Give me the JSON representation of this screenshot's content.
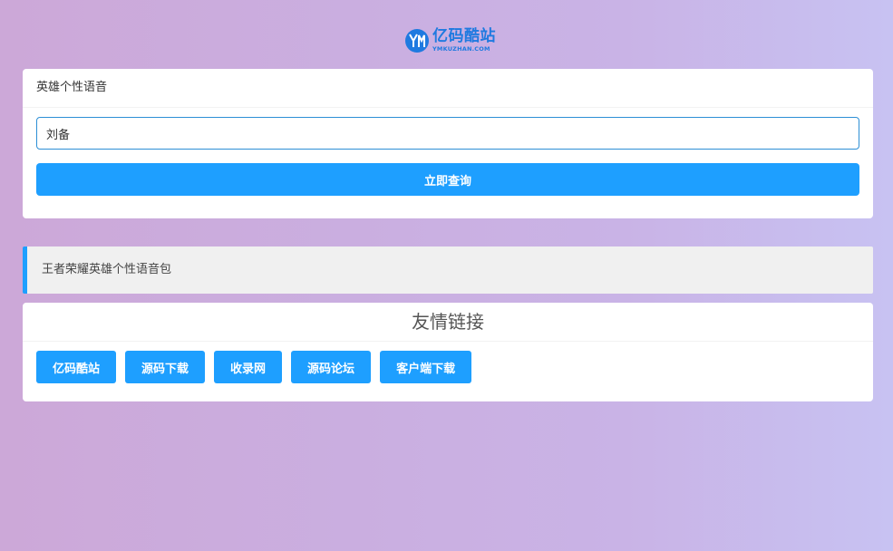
{
  "logo": {
    "name": "亿码酷站",
    "domain": "YMKUZHAN.COM",
    "color": "#1f7ae0"
  },
  "query_card": {
    "title": "英雄个性语音",
    "input_value": "刘备",
    "button_label": "立即查询"
  },
  "notice": {
    "text": "王者荣耀英雄个性语音包"
  },
  "links_card": {
    "title": "友情链接",
    "links": [
      "亿码酷站",
      "源码下载",
      "收录网",
      "源码论坛",
      "客户端下载"
    ]
  },
  "colors": {
    "accent": "#1e9fff",
    "input_border": "#2d8fd5"
  }
}
